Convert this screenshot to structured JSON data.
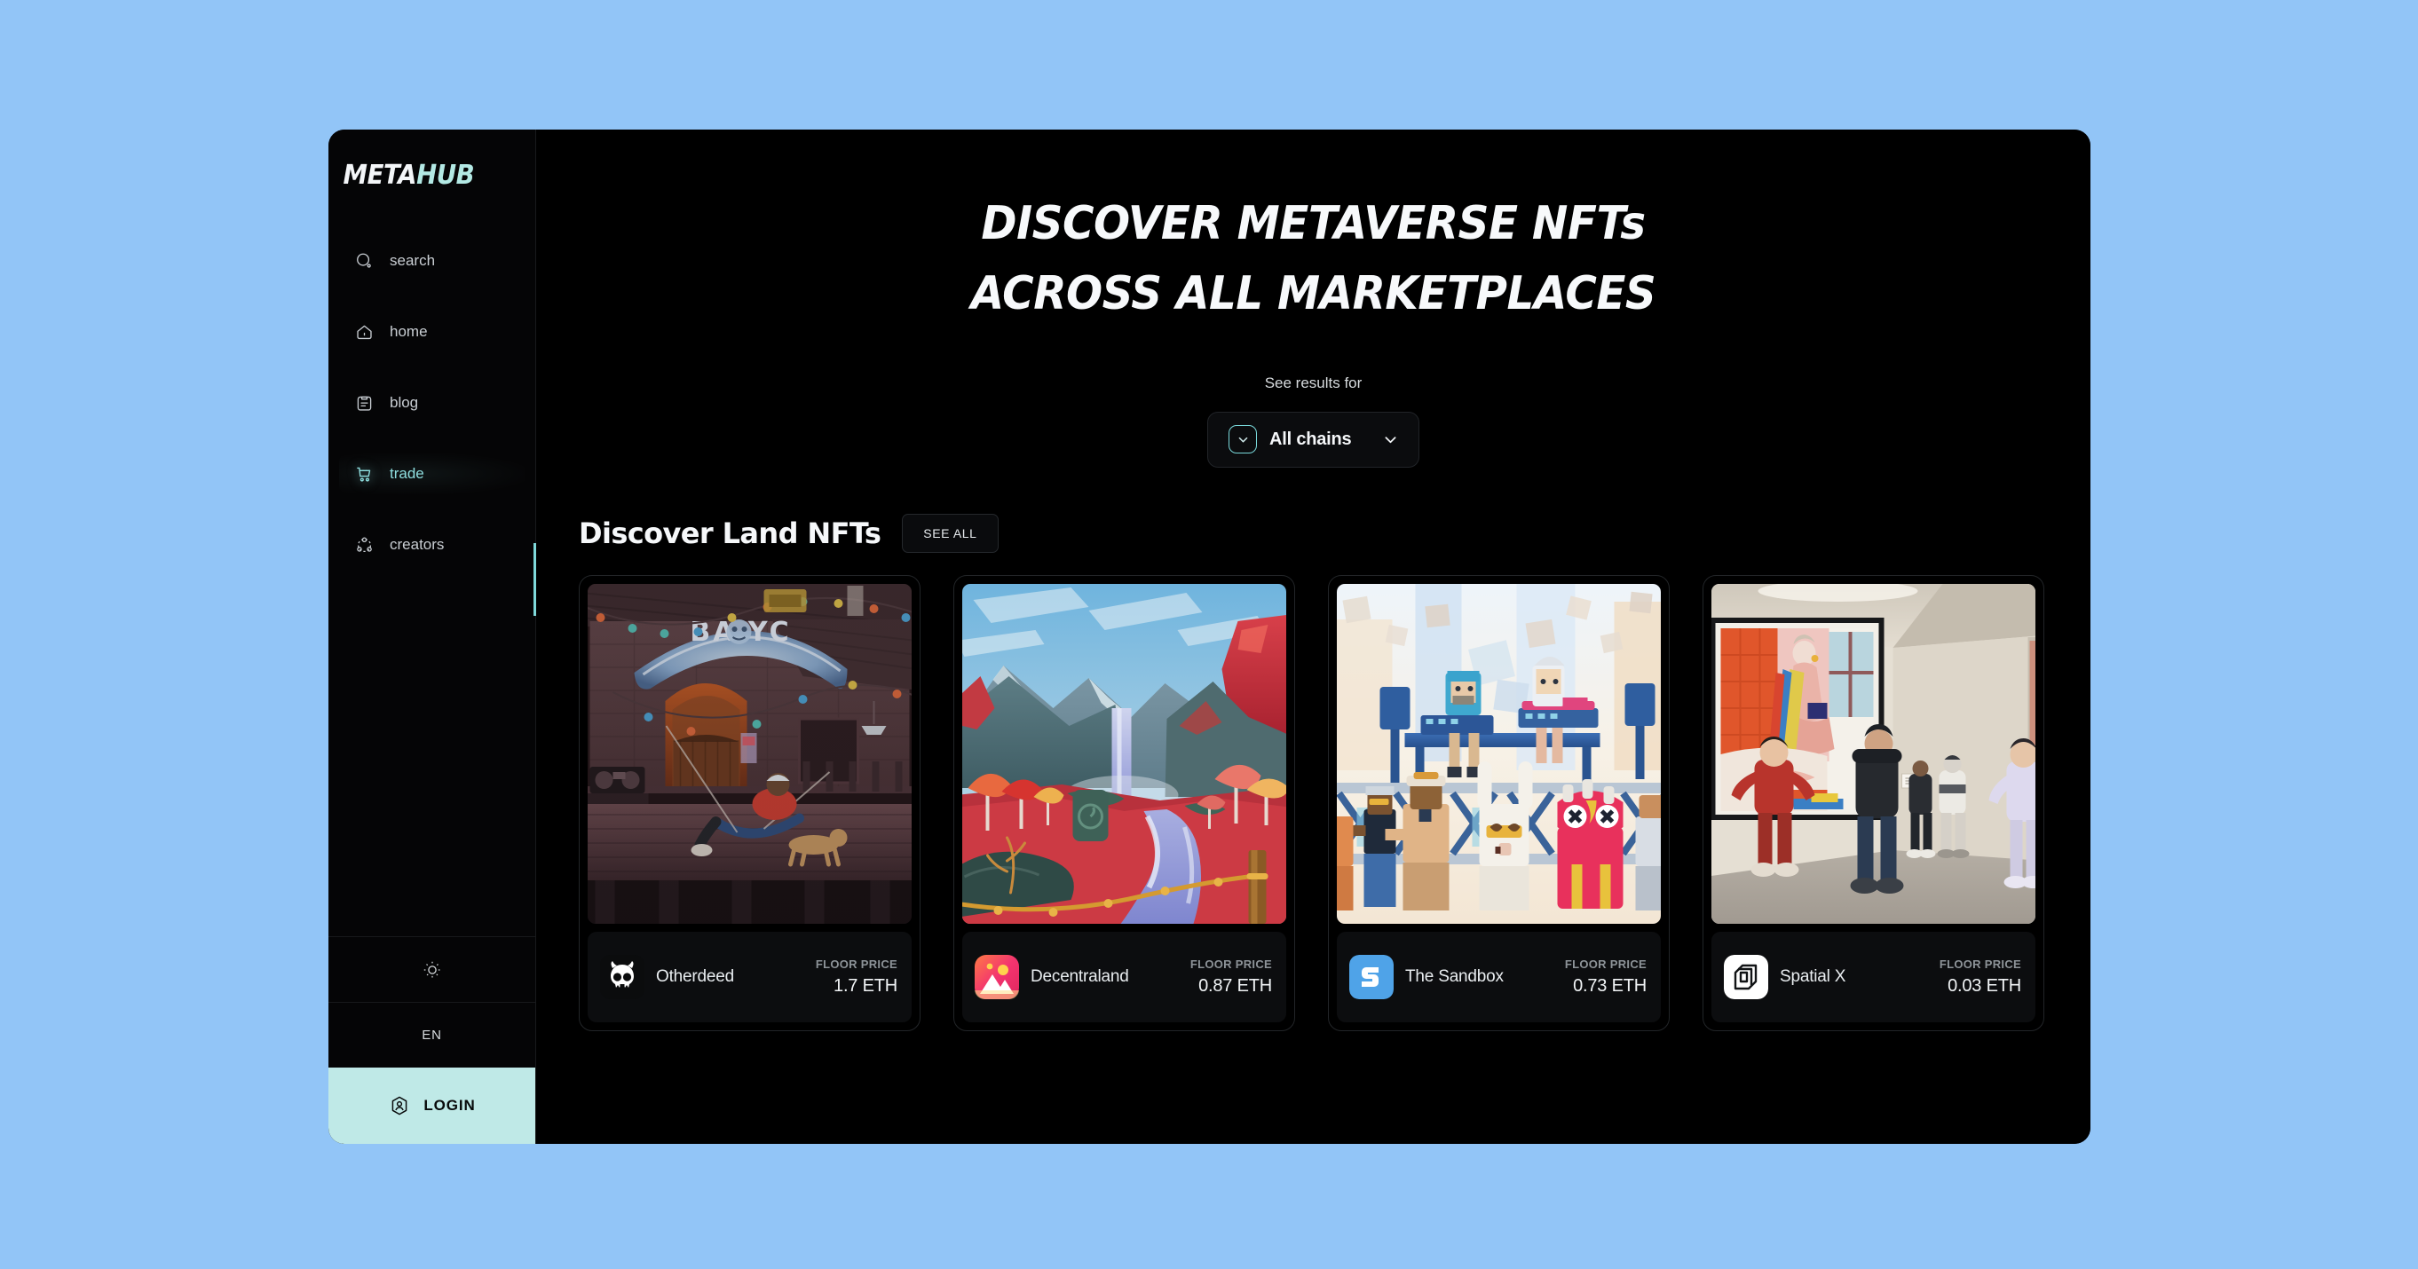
{
  "page": {
    "background_color": "#92c5f7",
    "app_background": "#000000",
    "accent_color": "#7fd9da",
    "login_button_color": "#bfe9e7"
  },
  "sidebar": {
    "brand": {
      "part1": "META",
      "part2": "HUB"
    },
    "items": [
      {
        "label": "search",
        "icon": "search-icon",
        "active": false
      },
      {
        "label": "home",
        "icon": "home-icon",
        "active": false
      },
      {
        "label": "blog",
        "icon": "blog-icon",
        "active": false
      },
      {
        "label": "trade",
        "icon": "cart-icon",
        "active": true
      },
      {
        "label": "creators",
        "icon": "creators-icon",
        "active": false
      }
    ],
    "theme_toggle": {
      "icon": "sun-icon",
      "label": ""
    },
    "language": {
      "label": "EN"
    },
    "login": {
      "label": "LOGIN",
      "icon": "user-hexagon-icon"
    }
  },
  "hero": {
    "line1": "DISCOVER METAVERSE NFTs",
    "line2": "ACROSS ALL MARKETPLACES",
    "see_results_for": "See results for",
    "chain_selector": {
      "value": "All chains",
      "badge_icon": "chevron-down-icon",
      "caret_icon": "chevron-down-icon"
    }
  },
  "section": {
    "title": "Discover Land NFTs",
    "see_all_label": "SEE ALL"
  },
  "cards": [
    {
      "name": "Otherdeed",
      "floor_price_label": "FLOOR PRICE",
      "floor_price": "1.7 ETH",
      "logo_icon": "otherdeed-skull-logo",
      "image": "bayc-saloon-night-scene"
    },
    {
      "name": "Decentraland",
      "floor_price_label": "FLOOR PRICE",
      "floor_price": "0.87 ETH",
      "logo_icon": "decentraland-mountains-logo",
      "image": "stylized-waterfall-valley-landscape"
    },
    {
      "name": "The Sandbox",
      "floor_price_label": "FLOOR PRICE",
      "floor_price": "0.73 ETH",
      "logo_icon": "sandbox-s-logo",
      "image": "voxel-concert-crowd-scene"
    },
    {
      "name": "Spatial X",
      "floor_price_label": "FLOOR PRICE",
      "floor_price": "0.03 ETH",
      "logo_icon": "spatial-layers-logo",
      "image": "virtual-art-gallery-avatars"
    }
  ]
}
